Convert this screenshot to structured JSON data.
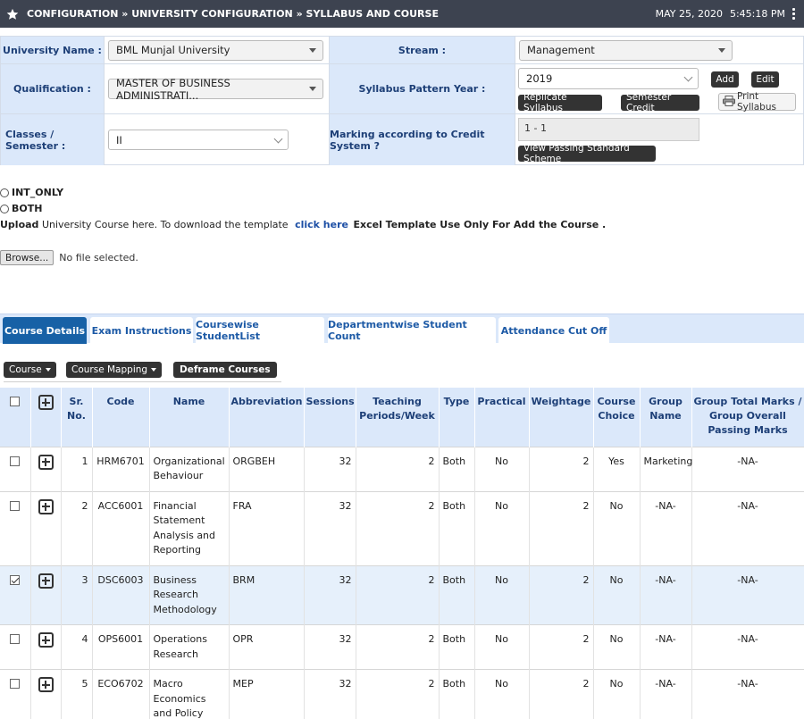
{
  "header": {
    "breadcrumb": "CONFIGURATION » UNIVERSITY CONFIGURATION » SYLLABUS AND COURSE",
    "date": "MAY 25, 2020",
    "time": "5:45:18 PM"
  },
  "form": {
    "university_label": "University Name :",
    "university_value": "BML Munjal University",
    "stream_label": "Stream :",
    "stream_value": "Management",
    "qualification_label": "Qualification :",
    "qualification_value": "MASTER OF BUSINESS ADMINISTRATI...",
    "pattern_year_label": "Syllabus Pattern Year :",
    "pattern_year_value": "2019",
    "add_label": "Add",
    "edit_label": "Edit",
    "replicate_label": "Replicate Syllabus",
    "semester_credit_label": "Semester Credit",
    "print_label": "Print Syllabus",
    "classes_label": "Classes / Semester :",
    "classes_value": "II",
    "marking_label": "Marking according to Credit System ?",
    "marking_value": "1 - 1",
    "view_passing_label": "View Passing Standard Scheme"
  },
  "options": {
    "int_only": "INT_ONLY",
    "both": "BOTH"
  },
  "upload": {
    "prefix_bold": "Upload",
    "text": "University Course here. To download the template",
    "link": "click here",
    "suffix_bold": "Excel Template Use Only For Add the Course ."
  },
  "file": {
    "browse_label": "Browse...",
    "status": "No file selected."
  },
  "tabs": [
    {
      "label": "Course Details"
    },
    {
      "label": "Exam Instructions"
    },
    {
      "label": "Coursewise StudentList"
    },
    {
      "label": "Departmentwise Student Count"
    },
    {
      "label": "Attendance Cut Off"
    }
  ],
  "toolbar": {
    "course_label": "Course",
    "course_mapping_label": "Course Mapping",
    "deframe_label": "Deframe Courses"
  },
  "table": {
    "headers": {
      "sr": "Sr. No.",
      "code": "Code",
      "name": "Name",
      "abbreviation": "Abbreviation",
      "sessions": "Sessions",
      "teaching": "Teaching Periods/Week",
      "type": "Type",
      "practical": "Practical",
      "weightage": "Weightage",
      "choice": "Course Choice",
      "group": "Group Name",
      "group_total": "Group Total Marks / Group Overall Passing Marks"
    },
    "rows": [
      {
        "sr": "1",
        "code": "HRM6701",
        "name": "Organizational Behaviour",
        "abbr": "ORGBEH",
        "sessions": "32",
        "teaching": "2",
        "type": "Both",
        "practical": "No",
        "weightage": "2",
        "choice": "Yes",
        "group": "Marketing",
        "group_total": "-NA-",
        "checked": false
      },
      {
        "sr": "2",
        "code": "ACC6001",
        "name": "Financial Statement Analysis and Reporting",
        "abbr": "FRA",
        "sessions": "32",
        "teaching": "2",
        "type": "Both",
        "practical": "No",
        "weightage": "2",
        "choice": "No",
        "group": "-NA-",
        "group_total": "-NA-",
        "checked": false
      },
      {
        "sr": "3",
        "code": "DSC6003",
        "name": "Business Research Methodology",
        "abbr": "BRM",
        "sessions": "32",
        "teaching": "2",
        "type": "Both",
        "practical": "No",
        "weightage": "2",
        "choice": "No",
        "group": "-NA-",
        "group_total": "-NA-",
        "checked": true
      },
      {
        "sr": "4",
        "code": "OPS6001",
        "name": "Operations Research",
        "abbr": "OPR",
        "sessions": "32",
        "teaching": "2",
        "type": "Both",
        "practical": "No",
        "weightage": "2",
        "choice": "No",
        "group": "-NA-",
        "group_total": "-NA-",
        "checked": false
      },
      {
        "sr": "5",
        "code": "ECO6702",
        "name": "Macro Economics and Policy",
        "abbr": "MEP",
        "sessions": "32",
        "teaching": "2",
        "type": "Both",
        "practical": "No",
        "weightage": "2",
        "choice": "No",
        "group": "-NA-",
        "group_total": "-NA-",
        "checked": false
      }
    ]
  }
}
